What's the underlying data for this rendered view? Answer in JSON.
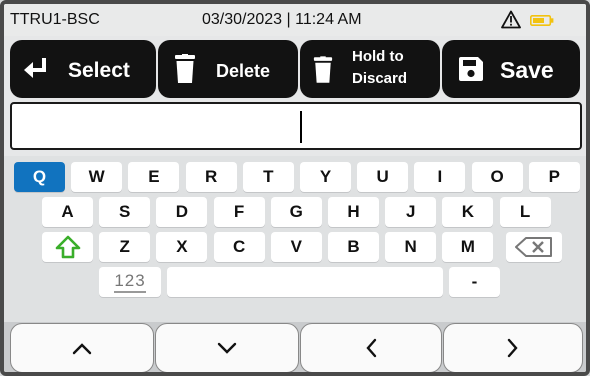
{
  "status_bar": {
    "device_name": "TTRU1-BSC",
    "datetime": "03/30/2023 | 11:24 AM",
    "warning_icon": "warning-triangle-icon",
    "battery_icon": "battery-icon",
    "battery_color": "#f2c20f"
  },
  "toolbar": {
    "select_label": "Select",
    "delete_label": "Delete",
    "discard_label_line1": "Hold to",
    "discard_label_line2": "Discard",
    "save_label": "Save"
  },
  "text_field": {
    "value": ""
  },
  "keyboard": {
    "row1": [
      "Q",
      "W",
      "E",
      "R",
      "T",
      "Y",
      "U",
      "I",
      "O",
      "P"
    ],
    "row2": [
      "A",
      "S",
      "D",
      "F",
      "G",
      "H",
      "J",
      "K",
      "L"
    ],
    "row3": [
      "Z",
      "X",
      "C",
      "V",
      "B",
      "N",
      "M"
    ],
    "highlighted_key": "Q",
    "highlight_color": "#1173bf",
    "shift_icon": "shift-arrow-icon",
    "shift_color": "#3aae2a",
    "backspace_icon": "backspace-icon",
    "numbers_label": "123",
    "dash_label": "-"
  },
  "nav": {
    "up_icon": "chevron-up-icon",
    "down_icon": "chevron-down-icon",
    "left_icon": "chevron-left-icon",
    "right_icon": "chevron-right-icon"
  }
}
